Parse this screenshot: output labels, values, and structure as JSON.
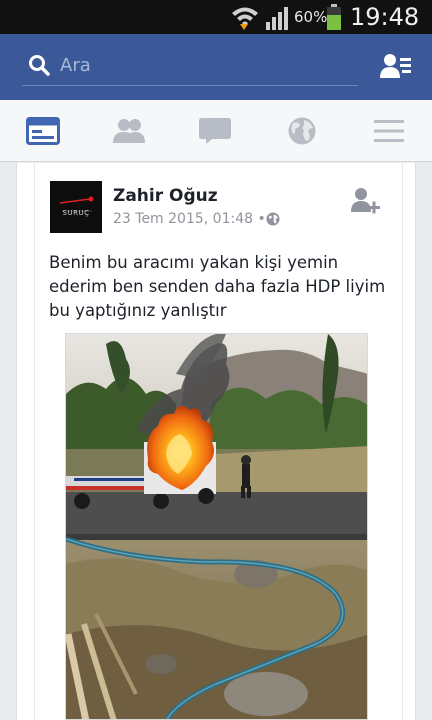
{
  "status_bar": {
    "battery_percent": "60%",
    "time": "19:48"
  },
  "search": {
    "placeholder": "Ara"
  },
  "nav": {
    "tabs": [
      {
        "icon": "news-feed-icon",
        "active": true
      },
      {
        "icon": "friends-icon",
        "active": false
      },
      {
        "icon": "messages-icon",
        "active": false
      },
      {
        "icon": "globe-icon",
        "active": false
      },
      {
        "icon": "menu-icon",
        "active": false
      }
    ]
  },
  "post": {
    "author": "Zahir Oğuz",
    "timestamp": "23 Tem 2015, 01:48",
    "separator": "•",
    "avatar_text": "SURUÇ",
    "text": "Benim bu aracımı yakan kişi yemin ederim ben senden daha fazla HDP liyim bu yaptığınız yanlıştır"
  },
  "colors": {
    "brand": "#3b5998",
    "nav_active": "#4267b2",
    "nav_inactive": "#b8bcc4",
    "fire": "#ff8c1a"
  }
}
